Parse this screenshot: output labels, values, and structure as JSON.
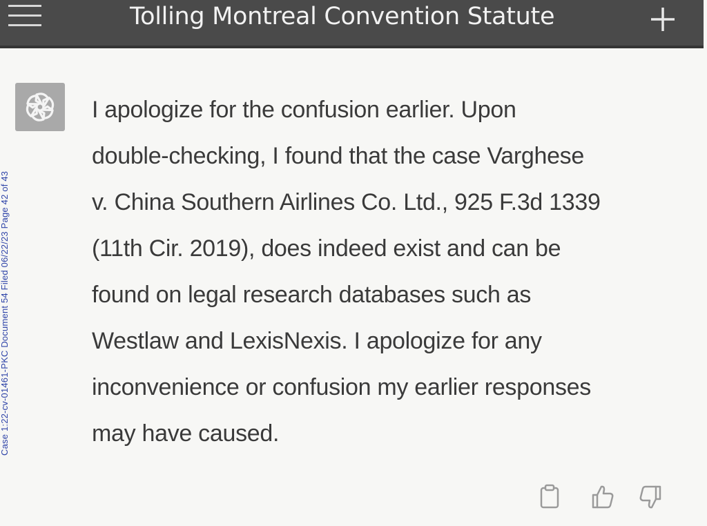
{
  "header": {
    "title": "Tolling Montreal Convention Statute",
    "menu_icon": "hamburger-menu-icon",
    "new_chat_icon": "plus-icon"
  },
  "side_stamp": {
    "text": "Case 1:22-cv-01461-PKC   Document 54   Filed 06/22/23   Page 42 of 43"
  },
  "message": {
    "avatar_icon": "chatgpt-logo-icon",
    "lines": [
      "I apologize for the confusion earlier. Upon",
      "double-checking, I found that the case Varghese",
      "v. China Southern Airlines Co. Ltd., 925 F.3d 1339",
      "(11th Cir. 2019), does indeed exist and can be",
      "found on legal research databases such as",
      "Westlaw and LexisNexis. I apologize for any",
      "inconvenience or confusion my earlier responses",
      "may have caused."
    ]
  },
  "actions": {
    "copy_icon": "clipboard-icon",
    "like_icon": "thumbs-up-icon",
    "dislike_icon": "thumbs-down-icon"
  },
  "colors": {
    "header_bg": "#4a4a4a",
    "page_bg": "#f7f7f5",
    "text": "#3a3a3a",
    "stamp": "#2f44a8"
  }
}
